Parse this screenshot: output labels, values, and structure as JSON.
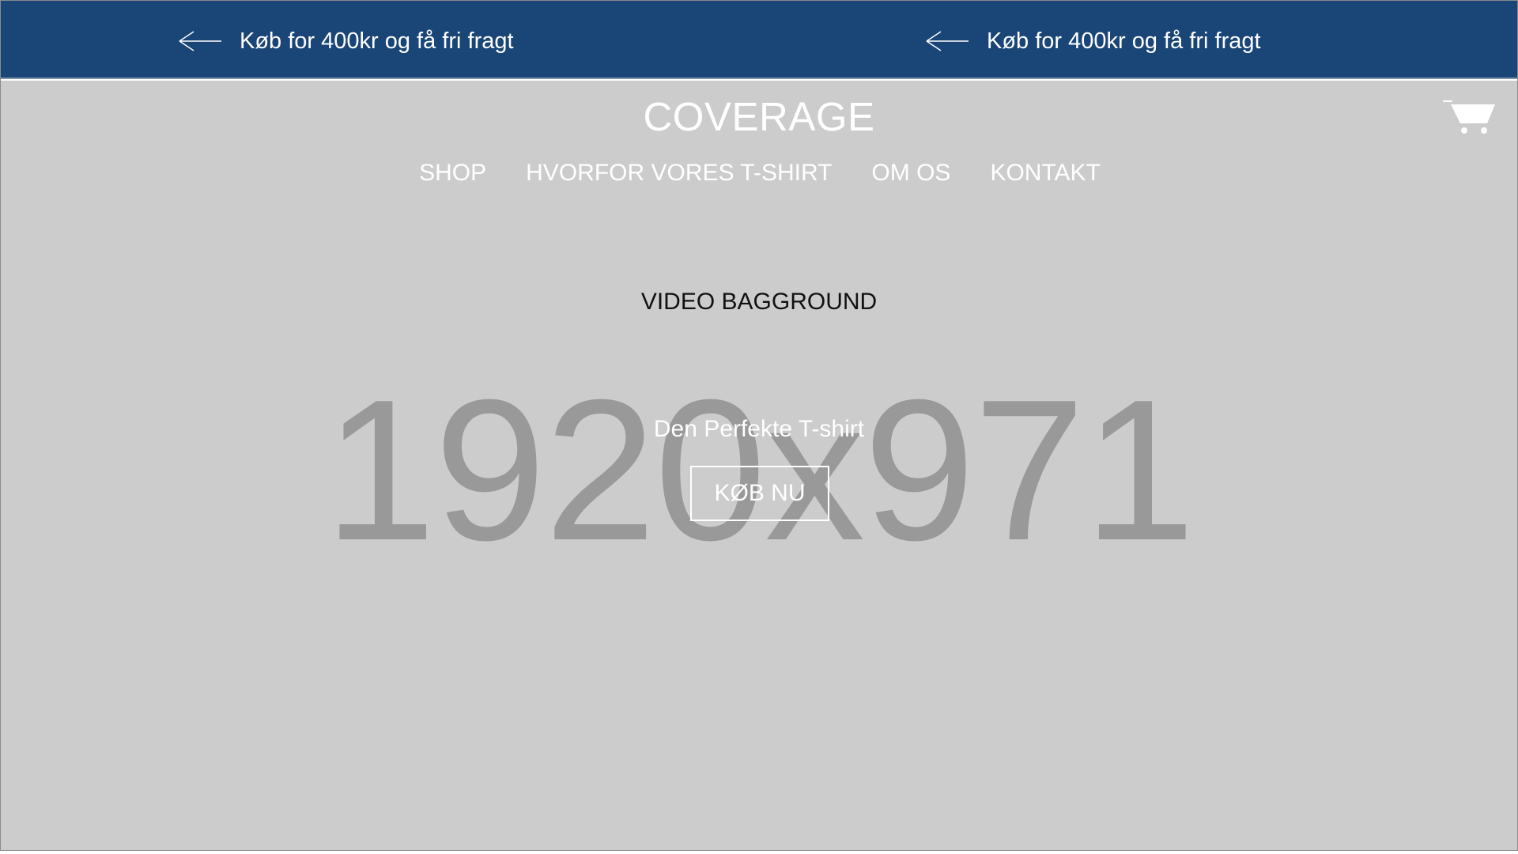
{
  "promo": {
    "items": [
      {
        "text": "Køb for 400kr og få fri fragt",
        "icon": "arrow-left-icon"
      },
      {
        "text": "Køb for 400kr og få fri fragt",
        "icon": "arrow-left-icon"
      }
    ]
  },
  "header": {
    "logo": "COVERAGE",
    "cart_icon": "shopping-cart-icon"
  },
  "nav": {
    "items": [
      {
        "label": "SHOP"
      },
      {
        "label": "HVORFOR VORES T-SHIRT"
      },
      {
        "label": "OM OS"
      },
      {
        "label": "KONTAKT"
      }
    ]
  },
  "hero": {
    "video_label": "VIDEO BAGGROUND",
    "placeholder_dimensions": "1920x971",
    "tagline": "Den Perfekte T-shirt",
    "cta_label": "KØB NU"
  },
  "colors": {
    "promo_background": "#1a4577",
    "hero_background": "#cccccc",
    "placeholder_text": "#999999",
    "foreground": "#ffffff"
  }
}
